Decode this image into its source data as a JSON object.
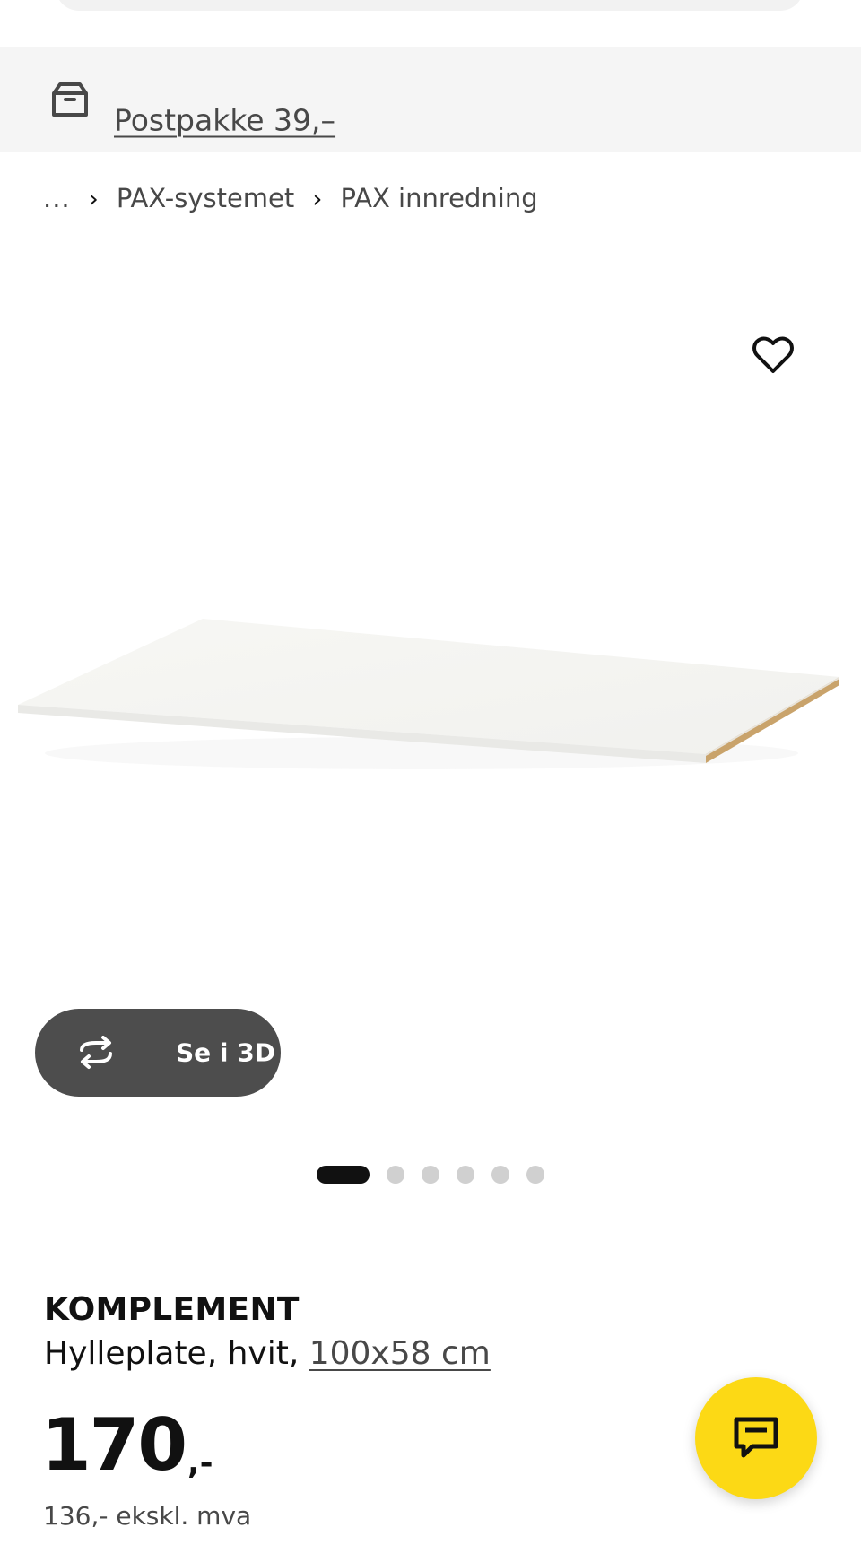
{
  "shipping": {
    "label": "Postpakke 39,–",
    "icon": "package-box-icon"
  },
  "breadcrumb": {
    "ellipsis": "...",
    "separator": "›",
    "items": [
      "PAX-systemet",
      "PAX innredning"
    ]
  },
  "gallery": {
    "favourite_icon": "heart-icon",
    "view3d_label": "Se i 3D",
    "view3d_icon": "rotate-3d-icon",
    "slide_count": 6,
    "active_slide": 1
  },
  "product": {
    "name": "KOMPLEMENT",
    "description": "Hylleplate, hvit, ",
    "size": "100x58 cm",
    "price_amount": "170",
    "price_suffix": ",-",
    "price_ex_vat": "136,- ekskl. mva"
  },
  "chat": {
    "icon": "chat-bubble-icon",
    "accent_color": "#fcd915"
  },
  "colors": {
    "banner_bg": "#f5f5f5",
    "button_3d_bg": "#4d4d4d",
    "dot_active": "#111111",
    "dot_inactive": "#d0d0d0"
  }
}
